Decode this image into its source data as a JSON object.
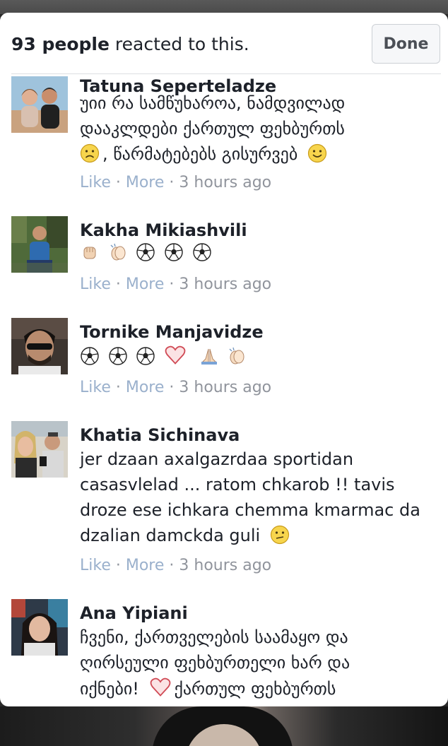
{
  "header": {
    "count": "93 people",
    "suffix": " reacted to this.",
    "done_label": "Done"
  },
  "meta": {
    "like": "Like",
    "sep1": " · ",
    "more": "More",
    "sep2": " · ",
    "time": "3 hours ago"
  },
  "comments": [
    {
      "name": "Tatuna Seperteladze",
      "lines": [
        "უიი რა სამწუხაროა, ნამდვილად",
        "დააკლდები ქართულ ფეხბურთს",
        ", წარმატებებს გისურვებ"
      ],
      "emoji": [
        "sad-face",
        "smile-face"
      ]
    },
    {
      "name": "Kakha Mikiashvili",
      "emoji": [
        "raised-fist",
        "clapping-hands",
        "soccer-ball",
        "soccer-ball",
        "soccer-ball"
      ]
    },
    {
      "name": "Tornike Manjavidze",
      "emoji": [
        "soccer-ball",
        "soccer-ball",
        "soccer-ball",
        "heart",
        "folded-hands",
        "clapping-hands"
      ]
    },
    {
      "name": "Khatia Sichinava",
      "lines": [
        "jer dzaan axalgazrdaa sportidan",
        "casasvlelad ... ratom chkarob !! tavis",
        "droze ese ichkara chemma kmarmac da",
        "dzalian damckda guli"
      ],
      "emoji": [
        "confused-face"
      ]
    },
    {
      "name": "Ana Yipiani",
      "lines": [
        "ჩვენი, ქართველების საამაყო და",
        "ღირსეული ფეხბურთელი ხარ და",
        "იქნები!",
        "ქართულ ფეხბურთს"
      ],
      "emoji": [
        "heart"
      ]
    }
  ],
  "colors": {
    "link": "#9ab0cc",
    "meta": "#90949c",
    "text": "#1d2129"
  }
}
